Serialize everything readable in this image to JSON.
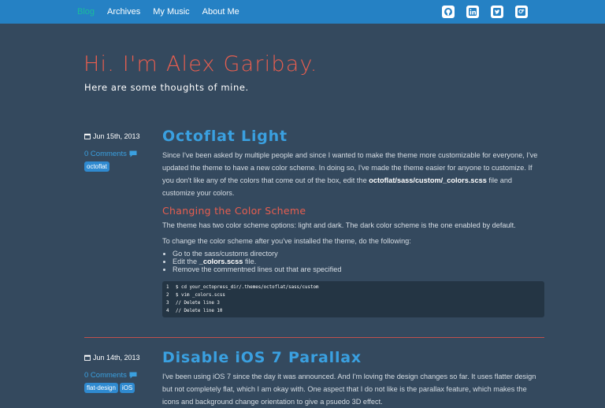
{
  "nav": {
    "items": [
      {
        "label": "Blog",
        "active": true
      },
      {
        "label": "Archives",
        "active": false
      },
      {
        "label": "My Music",
        "active": false
      },
      {
        "label": "About Me",
        "active": false
      }
    ]
  },
  "social": [
    {
      "icon": "github-icon"
    },
    {
      "icon": "linkedin-icon"
    },
    {
      "icon": "twitter-icon"
    },
    {
      "icon": "google-plus-icon"
    }
  ],
  "header": {
    "title": "Hi. I'm Alex Garibay.",
    "subtitle": "Here are some thoughts of mine."
  },
  "posts": [
    {
      "date": "Jun 15th, 2013",
      "comments": "0 Comments",
      "tags": [
        "octoflat"
      ],
      "title": "Octoflat Light",
      "intro_before": "Since I've been asked by multiple people and since I wanted to make the theme more customizable for everyone, I've updated the theme to have a new color scheme. In doing so, I've made the theme easier for anyone to customize. If you don't like any of the colors that come out of the box, edit the ",
      "intro_file": "octoflat/sass/custom/_colors.scss",
      "intro_after": " file and customize your colors.",
      "section_heading": "Changing the Color Scheme",
      "para1": "The theme has two color scheme options: light and dark. The dark color scheme is the one enabled by default.",
      "para2": "To change the color scheme after you've installed the theme, do the following:",
      "list": [
        {
          "before": "Go to the sass/customs directory",
          "bold": "",
          "after": ""
        },
        {
          "before": "Edit the ",
          "bold": "_colors.scss",
          "after": " file."
        },
        {
          "before": "Remove the commentned lines out that are specified",
          "bold": "",
          "after": ""
        }
      ],
      "code": [
        {
          "n": "1",
          "text": "$ cd your_octopress_dir/.themes/octoflat/sass/custom"
        },
        {
          "n": "2",
          "text": "$ vim _colors.scss"
        },
        {
          "n": "3",
          "text": "// Delete line 3"
        },
        {
          "n": "4",
          "text": "// Delete line 10"
        }
      ]
    },
    {
      "date": "Jun 14th, 2013",
      "comments": "0 Comments",
      "tags": [
        "flat-design",
        "iOS"
      ],
      "title": "Disable iOS 7 Parallax",
      "intro": "I've been using iOS 7 since the day it was announced. And I'm loving the design changes so far. It uses flatter design but not completely flat, which I am okay with. One aspect that I do not like is the parallax feature, which makes the icons and background change orientation to give a psuedo 3D effect."
    }
  ],
  "colors": {
    "background": "#34495e",
    "topbar": "#2581c4",
    "accent_red": "#e85e4f",
    "link_blue": "#3aa0e0",
    "nav_active": "#1abc9c"
  }
}
